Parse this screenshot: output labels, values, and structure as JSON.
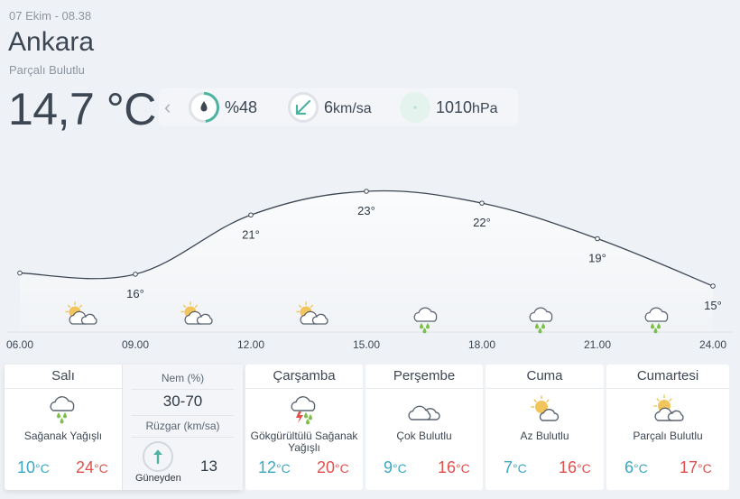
{
  "header": {
    "datetime": "07 Ekim - 08.38",
    "city": "Ankara",
    "condition": "Parçalı Bulutlu",
    "temperature": "14,7 °C"
  },
  "metrics": {
    "humidity": "%48",
    "humidity_fraction": 0.48,
    "wind_value": "6",
    "wind_unit": "km/sa",
    "pressure_value": "1010",
    "pressure_unit": "hPa"
  },
  "chart_data": {
    "type": "line",
    "x": [
      "06.00",
      "09.00",
      "12.00",
      "15.00",
      "18.00",
      "21.00",
      "24.00"
    ],
    "values": [
      null,
      16,
      21,
      23,
      22,
      19,
      15
    ],
    "first_point_estimate": 16.1,
    "labels": [
      "",
      "16°",
      "21°",
      "23°",
      "22°",
      "19°",
      "15°"
    ],
    "icons": [
      "partly-cloudy-icon",
      "partly-cloudy-icon",
      "partly-cloudy-icon",
      "rain-cloud-icon",
      "rain-cloud-icon",
      "rain-cloud-icon"
    ],
    "xlabel": "",
    "ylabel": "",
    "grid": false
  },
  "forecast": [
    {
      "day": "Salı",
      "desc": "Sağanak Yağışlı",
      "low": "10",
      "high": "24",
      "unit": "°C",
      "icon": "rain-cloud-icon"
    },
    {
      "day": "Çarşamba",
      "desc": "Gökgürültülü Sağanak Yağışlı",
      "low": "12",
      "high": "20",
      "unit": "°C",
      "icon": "thunder-rain-icon"
    },
    {
      "day": "Perşembe",
      "desc": "Çok Bulutlu",
      "low": "9",
      "high": "16",
      "unit": "°C",
      "icon": "cloudy-icon"
    },
    {
      "day": "Cuma",
      "desc": "Az Bulutlu",
      "low": "7",
      "high": "16",
      "unit": "°C",
      "icon": "mostly-sunny-icon"
    },
    {
      "day": "Cumartesi",
      "desc": "Parçalı Bulutlu",
      "low": "6",
      "high": "17",
      "unit": "°C",
      "icon": "partly-cloudy-icon"
    }
  ],
  "detail": {
    "humidity_label": "Nem (%)",
    "humidity_value": "30-70",
    "wind_label": "Rüzgar (km/sa)",
    "wind_direction": "Güneyden",
    "wind_speed": "13"
  },
  "colors": {
    "accent_green": "#4cb3a0",
    "low_temp": "#3ba8c4",
    "high_temp": "#e0514e",
    "sun": "#f2c55c",
    "rain": "#7cc04a",
    "thunder": "#e0514e"
  }
}
